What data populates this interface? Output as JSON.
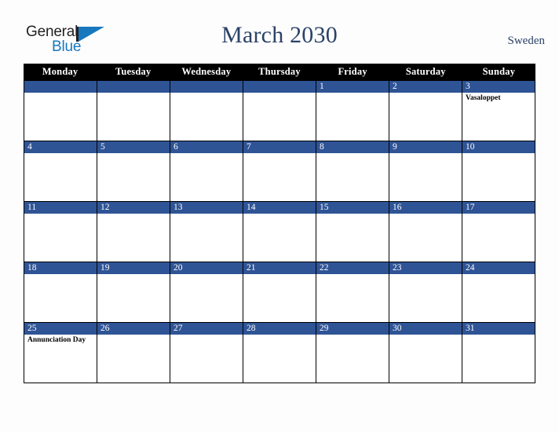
{
  "brand": {
    "line1": "General",
    "line2": "Blue",
    "mark_icon": "triangle-logo-icon",
    "dark_color": "#231f20",
    "blue_color": "#1878be"
  },
  "header": {
    "title": "March 2030",
    "region": "Sweden",
    "title_color": "#2b4268"
  },
  "calendar": {
    "month": "March",
    "year": "2030",
    "header_bg": "#000000",
    "daynum_bg": "#2f5496",
    "cell_bg": "#ffffff",
    "day_names": [
      "Monday",
      "Tuesday",
      "Wednesday",
      "Thursday",
      "Friday",
      "Saturday",
      "Sunday"
    ],
    "weeks": [
      [
        {
          "num": "",
          "events": []
        },
        {
          "num": "",
          "events": []
        },
        {
          "num": "",
          "events": []
        },
        {
          "num": "",
          "events": []
        },
        {
          "num": "1",
          "events": []
        },
        {
          "num": "2",
          "events": []
        },
        {
          "num": "3",
          "events": [
            "Vasaloppet"
          ]
        }
      ],
      [
        {
          "num": "4",
          "events": []
        },
        {
          "num": "5",
          "events": []
        },
        {
          "num": "6",
          "events": []
        },
        {
          "num": "7",
          "events": []
        },
        {
          "num": "8",
          "events": []
        },
        {
          "num": "9",
          "events": []
        },
        {
          "num": "10",
          "events": []
        }
      ],
      [
        {
          "num": "11",
          "events": []
        },
        {
          "num": "12",
          "events": []
        },
        {
          "num": "13",
          "events": []
        },
        {
          "num": "14",
          "events": []
        },
        {
          "num": "15",
          "events": []
        },
        {
          "num": "16",
          "events": []
        },
        {
          "num": "17",
          "events": []
        }
      ],
      [
        {
          "num": "18",
          "events": []
        },
        {
          "num": "19",
          "events": []
        },
        {
          "num": "20",
          "events": []
        },
        {
          "num": "21",
          "events": []
        },
        {
          "num": "22",
          "events": []
        },
        {
          "num": "23",
          "events": []
        },
        {
          "num": "24",
          "events": []
        }
      ],
      [
        {
          "num": "25",
          "events": [
            "Annunciation Day"
          ]
        },
        {
          "num": "26",
          "events": []
        },
        {
          "num": "27",
          "events": []
        },
        {
          "num": "28",
          "events": []
        },
        {
          "num": "29",
          "events": []
        },
        {
          "num": "30",
          "events": []
        },
        {
          "num": "31",
          "events": []
        }
      ]
    ]
  }
}
